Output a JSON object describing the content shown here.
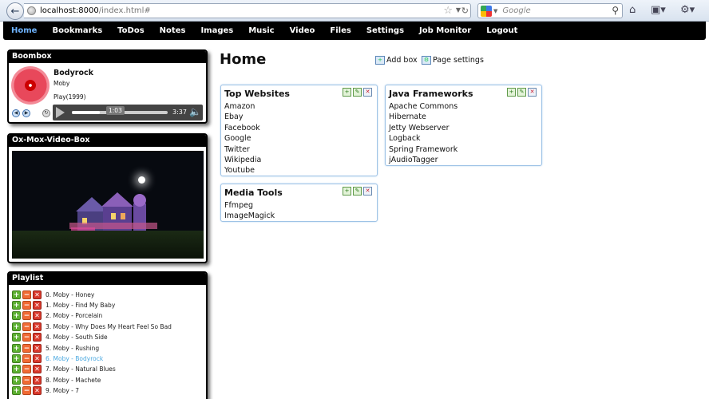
{
  "browser": {
    "url_host": "localhost:8000",
    "url_path": "/index.html#",
    "search_placeholder": "Google"
  },
  "nav": {
    "items": [
      "Home",
      "Bookmarks",
      "ToDos",
      "Notes",
      "Images",
      "Music",
      "Video",
      "Files",
      "Settings",
      "Job Monitor",
      "Logout"
    ],
    "active": "Home"
  },
  "boombox": {
    "title": "Boombox",
    "track": "Bodyrock",
    "artist": "Moby",
    "play_info": "Play(1999)",
    "current_time": "1:03",
    "duration": "3:37",
    "progress": 0.29
  },
  "videobox": {
    "title": "Ox-Mox-Video-Box"
  },
  "playlist": {
    "title": "Playlist",
    "items": [
      "0. Moby - Honey",
      "1. Moby - Find My Baby",
      "2. Moby - Porcelain",
      "3. Moby - Why Does My Heart Feel So Bad",
      "4. Moby - South Side",
      "5. Moby - Rushing",
      "6. Moby - Bodyrock",
      "7. Moby - Natural Blues",
      "8. Moby - Machete",
      "9. Moby - 7"
    ],
    "current_index": 6
  },
  "main": {
    "title": "Home",
    "add_box_label": "Add box",
    "page_settings_label": "Page settings",
    "boxes": [
      {
        "title": "Top Websites",
        "links": [
          "Amazon",
          "Ebay",
          "Facebook",
          "Google",
          "Twitter",
          "Wikipedia",
          "Youtube"
        ]
      },
      {
        "title": "Java Frameworks",
        "links": [
          "Apache Commons",
          "Hibernate",
          "Jetty Webserver",
          "Logback",
          "Spring Framework",
          "jAudioTagger"
        ]
      },
      {
        "title": "Media Tools",
        "links": [
          "Ffmpeg",
          "ImageMagick"
        ]
      }
    ]
  }
}
